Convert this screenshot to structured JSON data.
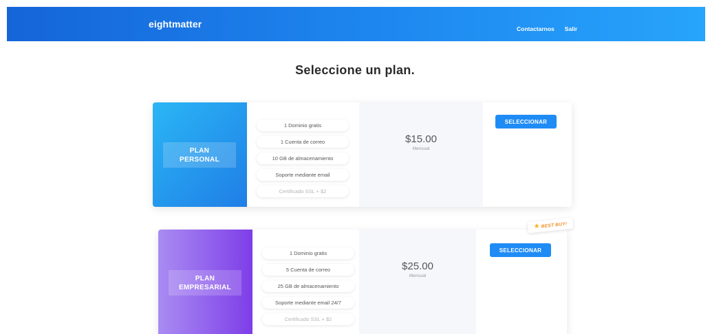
{
  "nav": {
    "brand": "eightmatter",
    "links": [
      "Contactarnos",
      "Salir"
    ]
  },
  "page": {
    "title": "Seleccione un plan."
  },
  "plans": [
    {
      "name": "PLAN\nPERSONAL",
      "features": [
        "1 Dominio gratis",
        "1 Cuenta de correo",
        "10 GB de almacenamiento",
        "Soporte mediante email",
        "Certificado SSL + $2"
      ],
      "price": "$15.00",
      "period": "Mensual",
      "button": "SELECCIONAR",
      "side_gradient": [
        "#2bb6f5",
        "#1f7ee6"
      ]
    },
    {
      "name": "PLAN\nEMPRESARIAL",
      "features": [
        "1 Dominio gratis",
        "5 Cuenta de correo",
        "25 GB de almacenamiento",
        "Soporte mediante email 24/7",
        "Certificado SSL + $2"
      ],
      "price": "$25.00",
      "period": "Mensual",
      "button": "SELECCIONAR",
      "badge": "BEST BUY!",
      "side_gradient": [
        "#a98cf2",
        "#7e3ee8"
      ]
    }
  ],
  "colors": {
    "accent": "#1f8cf5",
    "badge_text": "#ef8a1a",
    "star": "#f7b21d"
  },
  "icons": {
    "badge_icon": "star-icon"
  }
}
